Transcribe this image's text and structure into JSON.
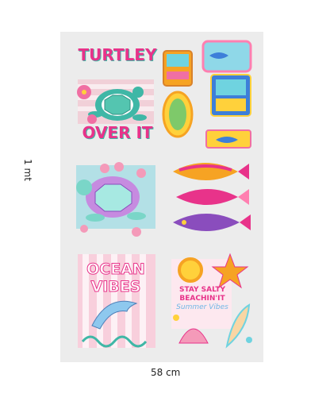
{
  "dimensions": {
    "width": "58 cm",
    "height": "1 mt"
  },
  "decals": {
    "turtle_title": {
      "line1": "TURTLEY",
      "line2": "OVER IT"
    },
    "ocean": {
      "line1": "OCEAN",
      "line2": "VIBES"
    },
    "beach": {
      "line1": "STAY SALTY",
      "line2": "BEACHIN'IT",
      "line3": "Summer Vibes"
    }
  },
  "colors": {
    "sheet": "#ececec",
    "pink": "#f06fa3",
    "hot_pink": "#e8338a",
    "teal": "#3fb7a6",
    "aqua": "#6fd3e0",
    "yellow": "#ffd13b",
    "orange": "#f6a323",
    "purple": "#8a4dbd",
    "blue": "#3d7fd9"
  }
}
